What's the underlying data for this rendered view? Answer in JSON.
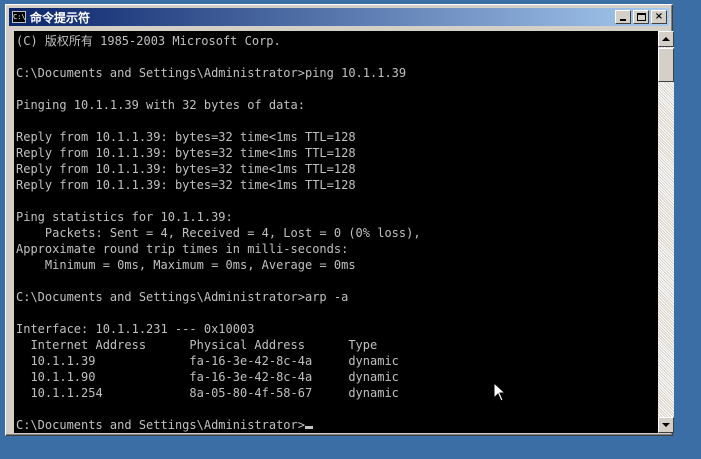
{
  "window": {
    "title": "命令提示符",
    "icon_label": "C:\\",
    "icon": "console-icon",
    "buttons": {
      "minimize": "minimize-icon",
      "maximize": "maximize-icon",
      "close": "×"
    }
  },
  "console": {
    "lines": [
      "(C) 版权所有 1985-2003 Microsoft Corp.",
      "",
      "C:\\Documents and Settings\\Administrator>ping 10.1.1.39",
      "",
      "Pinging 10.1.1.39 with 32 bytes of data:",
      "",
      "Reply from 10.1.1.39: bytes=32 time<1ms TTL=128",
      "Reply from 10.1.1.39: bytes=32 time<1ms TTL=128",
      "Reply from 10.1.1.39: bytes=32 time<1ms TTL=128",
      "Reply from 10.1.1.39: bytes=32 time<1ms TTL=128",
      "",
      "Ping statistics for 10.1.1.39:",
      "    Packets: Sent = 4, Received = 4, Lost = 0 (0% loss),",
      "Approximate round trip times in milli-seconds:",
      "    Minimum = 0ms, Maximum = 0ms, Average = 0ms",
      "",
      "C:\\Documents and Settings\\Administrator>arp -a",
      "",
      "Interface: 10.1.1.231 --- 0x10003",
      "  Internet Address      Physical Address      Type",
      "  10.1.1.39             fa-16-3e-42-8c-4a     dynamic",
      "  10.1.1.90             fa-16-3e-42-8c-4a     dynamic",
      "  10.1.1.254            8a-05-80-4f-58-67     dynamic",
      "",
      "C:\\Documents and Settings\\Administrator>"
    ]
  },
  "colors": {
    "console_bg": "#000000",
    "console_fg": "#c0c0c0",
    "desktop": "#3a6ea5",
    "titlebar_start": "#0a246a",
    "titlebar_end": "#a6caf0"
  }
}
